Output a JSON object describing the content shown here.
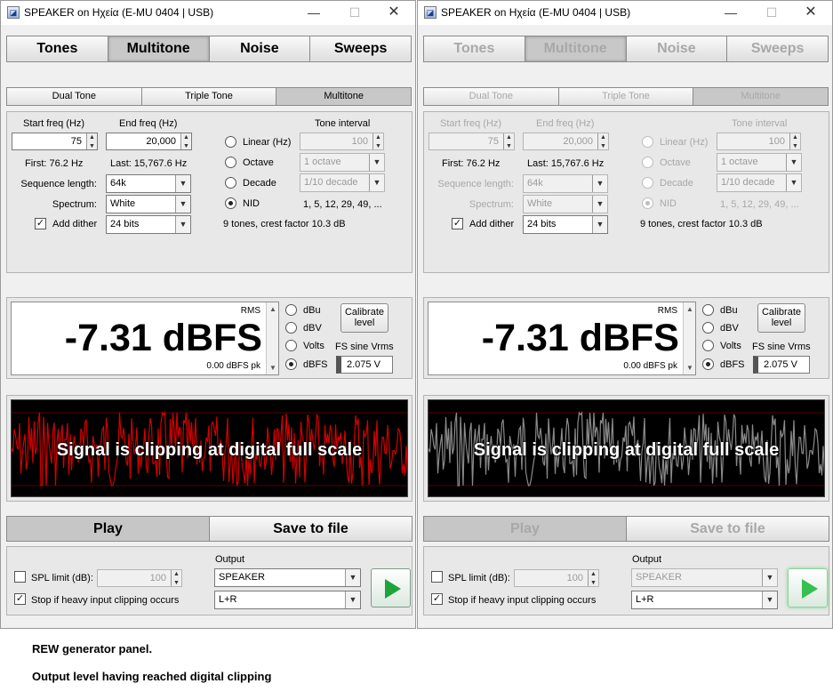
{
  "windows": [
    {
      "title": "SPEAKER on Ηχεία (E-MU 0404 | USB)",
      "enabled": true
    },
    {
      "title": "SPEAKER on Ηχεία (E-MU 0404 | USB)",
      "enabled": false
    }
  ],
  "window_controls": {
    "minimize": "—",
    "maximize": "☐",
    "close": "✕"
  },
  "main_tabs": [
    "Tones",
    "Multitone",
    "Noise",
    "Sweeps"
  ],
  "active_main_tab": "Multitone",
  "sub_tabs": [
    "Dual Tone",
    "Triple Tone",
    "Multitone"
  ],
  "active_sub_tab": "Multitone",
  "settings": {
    "start_freq_label": "Start freq (Hz)",
    "start_freq": "75",
    "end_freq_label": "End freq (Hz)",
    "end_freq": "20,000",
    "first": "First: 76.2 Hz",
    "last": "Last: 15,767.6 Hz",
    "sequence_length_label": "Sequence length:",
    "sequence_length": "64k",
    "spectrum_label": "Spectrum:",
    "spectrum": "White",
    "add_dither_label": "Add dither",
    "add_dither": true,
    "dither_bits": "24 bits",
    "tone_interval_label": "Tone interval",
    "tone_interval_value": "100",
    "options": [
      {
        "label": "Linear (Hz)",
        "selected": false
      },
      {
        "label": "Octave",
        "selected": false
      },
      {
        "label": "Decade",
        "selected": false
      },
      {
        "label": "NID",
        "selected": true
      }
    ],
    "octave_value": "1 octave",
    "decade_value": "1/10 decade",
    "nid_sequence": "1, 5, 12, 29, 49, ...",
    "summary": "9 tones, crest factor 10.3 dB"
  },
  "meter": {
    "rms_label": "RMS",
    "value": "-7.31 dBFS",
    "peak": "0.00 dBFS pk",
    "units": [
      {
        "label": "dBu",
        "selected": false
      },
      {
        "label": "dBV",
        "selected": false
      },
      {
        "label": "Volts",
        "selected": false
      },
      {
        "label": "dBFS",
        "selected": true
      }
    ],
    "calibrate_line1": "Calibrate",
    "calibrate_line2": "level",
    "fs_sine_label": "FS sine Vrms",
    "fs_sine_value": "2.075 V"
  },
  "waveform": {
    "message": "Signal is clipping at digital full scale",
    "color_active": "#d40000",
    "color_inactive": "#8a8a8a"
  },
  "play_tabs": [
    "Play",
    "Save to file"
  ],
  "active_play_tab": "Play",
  "output": {
    "spl_limit_label": "SPL limit (dB):",
    "spl_limit_checked": false,
    "spl_limit_value": "100",
    "stop_clipping_label": "Stop if heavy input clipping occurs",
    "stop_clipping_checked": true,
    "output_label": "Output",
    "output_device": "SPEAKER",
    "channel": "L+R"
  },
  "captions": [
    "REW generator panel.",
    "Output level having reached digital clipping"
  ]
}
